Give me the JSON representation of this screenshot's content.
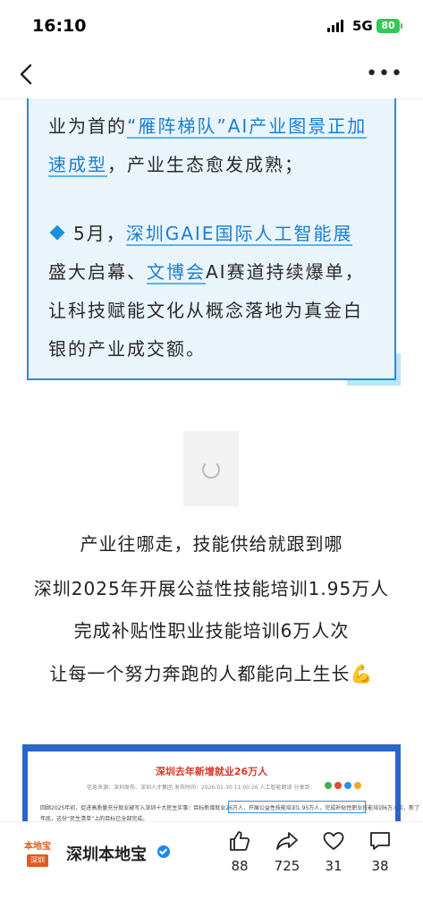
{
  "status": {
    "time": "16:10",
    "network": "5G",
    "battery": "80"
  },
  "nav": {
    "back": "back",
    "more": "•••"
  },
  "quote": {
    "line1_pre": "业为首的",
    "line1_hl": "“雁阵梯队”AI产业图景正加",
    "line2_hl": "速成型",
    "line2_post": "，产业生态愈发成熟；",
    "p2_pre": "5月，",
    "p2_hl1": "深圳GAIE国际人工智能展",
    "p2_mid1": "盛大启幕、",
    "p2_hl2": "文博会",
    "p2_mid2": "AI赛道持续爆单，",
    "p2_line3": "让科技赋能文化从概念落地为真金白",
    "p2_line4": "银的产业成交额。"
  },
  "lines": [
    "产业往哪走，技能供给就跟到哪",
    "深圳2025年开展公益性技能培训1.95万人",
    "完成补贴性职业技能培训6万人次",
    "让每一个努力奔跑的人都能向上生长"
  ],
  "muscle_icon": "💪",
  "news": {
    "title": "深圳去年新增就业26万人",
    "meta": "信息来源：深圳发布、深圳人才集团    发布时间：2026-01-30 11:00:26         人工智能朗读          分享到：",
    "body1": "回顾2025年初，促进高质量充分就业被写入深圳十大民生实事：目标新增就业26万人，开展公益性技能培训1.95万人，完成补贴性职业技能培训6万人次，新了",
    "body2": "年底，这份“民生清单”上的目标已全部完成。"
  },
  "bottom": {
    "logo_top": "本地宝",
    "logo_bottom": "深圳",
    "account": "深圳本地宝",
    "likes": "88",
    "shares": "725",
    "favorites": "31",
    "comments": "38"
  },
  "colors": {
    "accent": "#1a91e0",
    "quote_bg": "#eaf4fb",
    "brand": "#e25a1c"
  }
}
